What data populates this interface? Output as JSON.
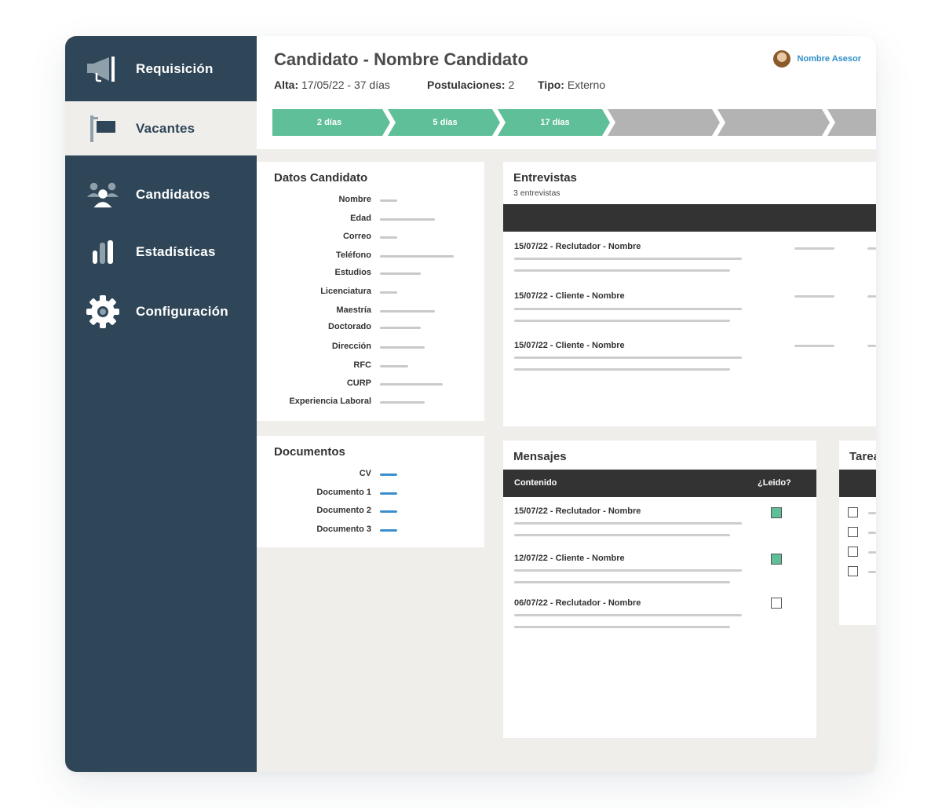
{
  "sidebar": {
    "items": [
      {
        "label": "Requisición",
        "icon": "megaphone-icon"
      },
      {
        "label": "Vacantes",
        "icon": "signpost-icon"
      },
      {
        "label": "Candidatos",
        "icon": "users-icon"
      },
      {
        "label": "Estadísticas",
        "icon": "bar-chart-icon"
      },
      {
        "label": "Configuración",
        "icon": "gear-icon"
      }
    ],
    "active": "Vacantes"
  },
  "header": {
    "title": "Candidato - Nombre Candidato",
    "alta_label": "Alta:",
    "alta_value": "17/05/22 - 37 días",
    "postulaciones_label": "Postulaciones:",
    "postulaciones_value": "2",
    "tipo_label": "Tipo:",
    "tipo_value": "Externo",
    "advisor": "Nombre Asesor"
  },
  "stages": [
    {
      "label": "2 días",
      "done": true
    },
    {
      "label": "5 días",
      "done": true
    },
    {
      "label": "17 días",
      "done": true
    },
    {
      "label": "",
      "done": false
    },
    {
      "label": "",
      "done": false
    },
    {
      "label": "",
      "done": false
    }
  ],
  "datos": {
    "title": "Datos Candidato",
    "fields": [
      "Nombre",
      "Edad",
      "Correo",
      "Teléfono",
      "Estudios",
      "Licenciatura",
      "Maestría",
      "Doctorado",
      "Dirección",
      "RFC",
      "CURP",
      "Experiencia Laboral"
    ]
  },
  "documentos": {
    "title": "Documentos",
    "items": [
      "CV",
      "Documento 1",
      "Documento 2",
      "Documento 3"
    ]
  },
  "entrevistas": {
    "title": "Entrevistas",
    "count": "3 entrevistas",
    "rows": [
      "15/07/22 - Reclutador - Nombre",
      "15/07/22 - Cliente - Nombre",
      "15/07/22 - Cliente - Nombre"
    ]
  },
  "mensajes": {
    "title": "Mensajes",
    "col_content": "Contenido",
    "col_read": "¿Leido?",
    "rows": [
      {
        "title": "15/07/22 - Reclutador - Nombre",
        "read": true
      },
      {
        "title": "12/07/22 - Cliente - Nombre",
        "read": true
      },
      {
        "title": "06/07/22 - Reclutador - Nombre",
        "read": false
      }
    ]
  },
  "tareas": {
    "title": "Tareas"
  },
  "colors": {
    "sidebar": "#2f4658",
    "stage_done": "#5ebf98",
    "stage_pending": "#b3b3b3",
    "link": "#2f8fc9",
    "doc_bar": "#3a8fd0"
  }
}
